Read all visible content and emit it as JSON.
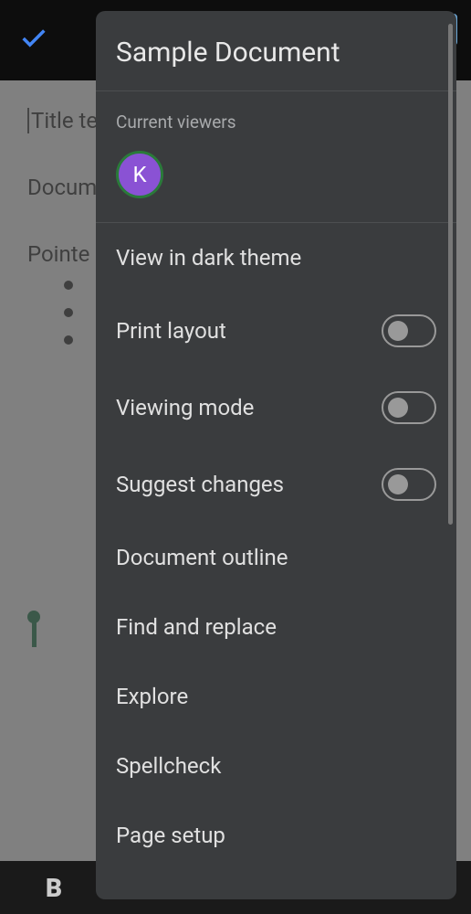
{
  "doc": {
    "line1": "Title te",
    "line2": "Docum",
    "line3": "Pointe"
  },
  "menu": {
    "title": "Sample Document",
    "viewers_label": "Current viewers",
    "viewers": [
      {
        "initial": "K"
      }
    ],
    "items": [
      {
        "label": "View in dark theme",
        "has_toggle": false
      },
      {
        "label": "Print layout",
        "has_toggle": true,
        "toggle_on": false
      },
      {
        "label": "Viewing mode",
        "has_toggle": true,
        "toggle_on": false
      },
      {
        "label": "Suggest changes",
        "has_toggle": true,
        "toggle_on": false
      },
      {
        "label": "Document outline",
        "has_toggle": false
      },
      {
        "label": "Find and replace",
        "has_toggle": false
      },
      {
        "label": "Explore",
        "has_toggle": false
      },
      {
        "label": "Spellcheck",
        "has_toggle": false
      },
      {
        "label": "Page setup",
        "has_toggle": false
      }
    ]
  },
  "toolbar": {
    "bold": "B"
  }
}
